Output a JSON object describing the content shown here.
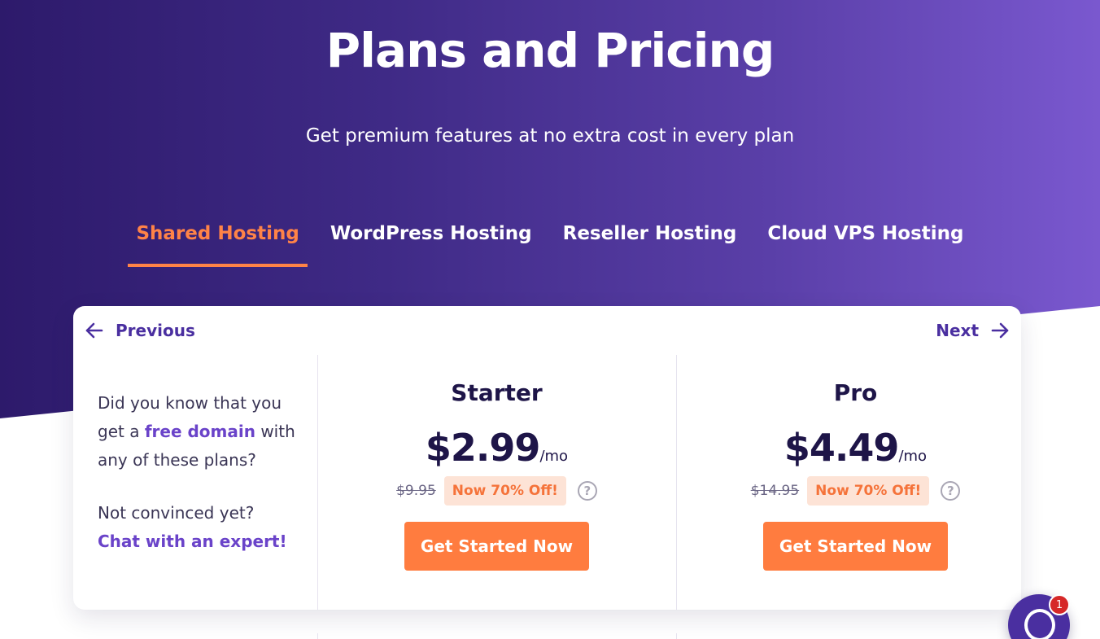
{
  "hero": {
    "title": "Plans and Pricing",
    "subtitle": "Get premium features at no extra cost in every plan"
  },
  "tabs": [
    {
      "label": "Shared Hosting",
      "active": true
    },
    {
      "label": "WordPress Hosting",
      "active": false
    },
    {
      "label": "Reseller Hosting",
      "active": false
    },
    {
      "label": "Cloud VPS Hosting",
      "active": false
    }
  ],
  "carousel": {
    "prev_label": "Previous",
    "next_label": "Next"
  },
  "intro": {
    "line1_a": "Did you know that you get a ",
    "line1_hl": "free domain",
    "line1_b": " with any of these plans?",
    "line2": "Not convinced yet?",
    "chat_link": "Chat with an expert!"
  },
  "plans": [
    {
      "name": "Starter",
      "price": "$2.99",
      "per": "/mo",
      "old_price": "$9.95",
      "badge": "Now 70% Off!",
      "cta": "Get Started Now"
    },
    {
      "name": "Pro",
      "price": "$4.49",
      "per": "/mo",
      "old_price": "$14.95",
      "badge": "Now 70% Off!",
      "cta": "Get Started Now"
    }
  ],
  "chat_widget": {
    "badge_count": "1"
  },
  "colors": {
    "accent": "#ff7c3f",
    "brand_purple": "#4a2fa0",
    "badge_bg": "#fde3d6"
  }
}
